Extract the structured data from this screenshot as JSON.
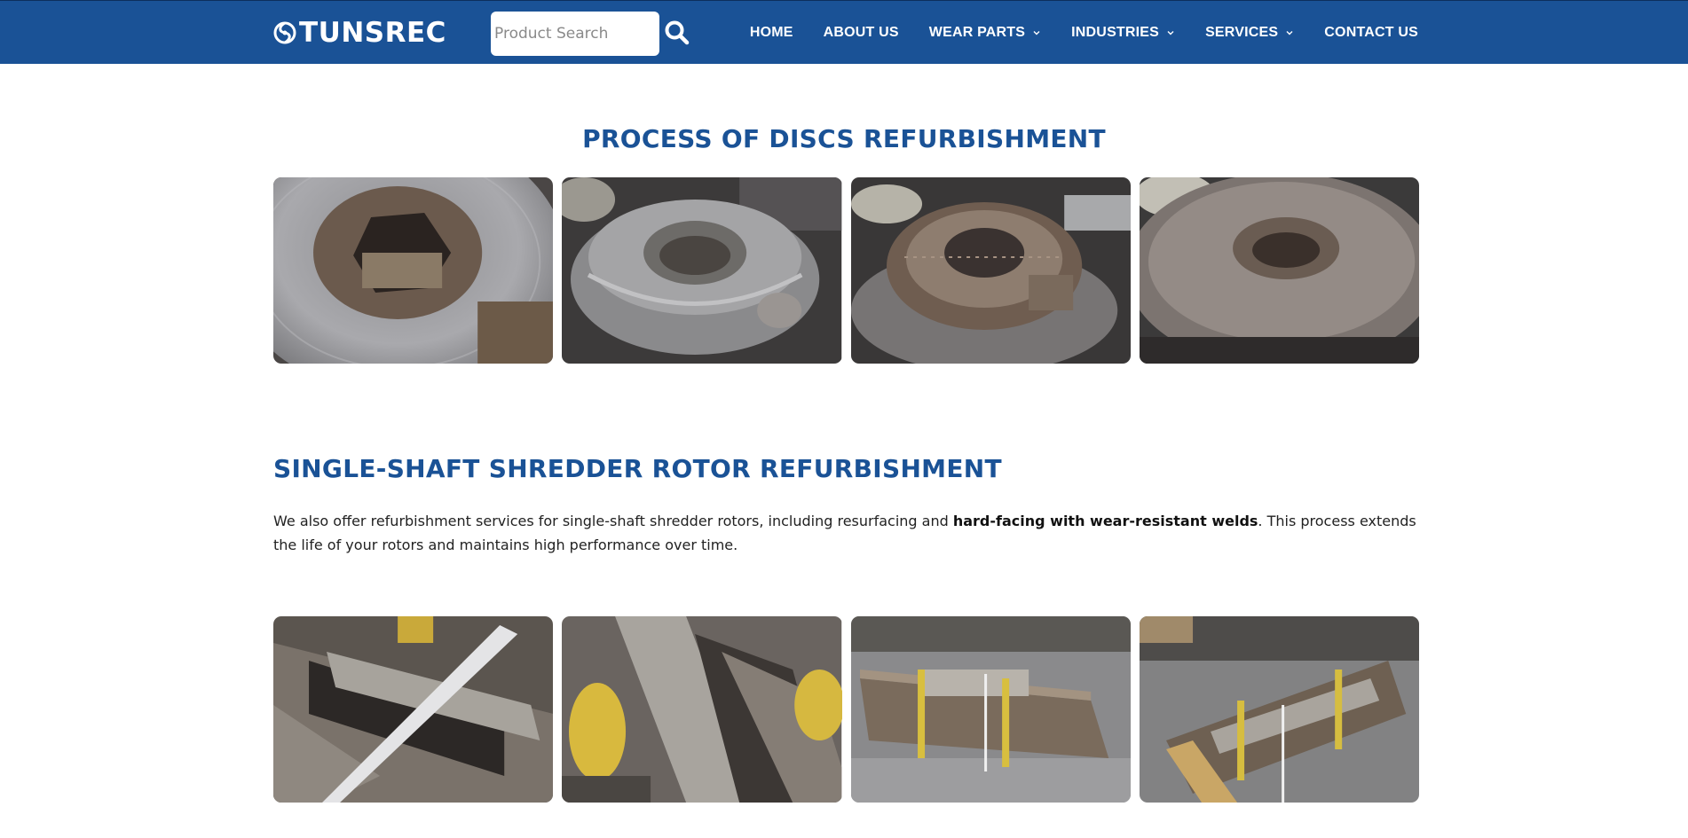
{
  "header": {
    "logo_text": "TUNSREC",
    "search_placeholder": "Product Search",
    "nav": [
      {
        "label": "HOME",
        "dropdown": false
      },
      {
        "label": "ABOUT US",
        "dropdown": false
      },
      {
        "label": "WEAR PARTS",
        "dropdown": true
      },
      {
        "label": "INDUSTRIES",
        "dropdown": true
      },
      {
        "label": "SERVICES",
        "dropdown": true,
        "active": true
      },
      {
        "label": "CONTACT US",
        "dropdown": false
      }
    ]
  },
  "discs": {
    "title": "PROCESS OF DISCS REFURBISHMENT"
  },
  "rotor": {
    "title": "SINGLE-SHAFT SHREDDER ROTOR REFURBISHMENT",
    "para_before": "We also offer refurbishment services for single-shaft shredder rotors, including resurfacing and ",
    "para_bold": "hard-facing with wear-resistant welds",
    "para_after": ". This process extends the life of your rotors and maintains high performance over time."
  },
  "colors": {
    "brand_blue": "#1a5296",
    "text": "#222222"
  }
}
